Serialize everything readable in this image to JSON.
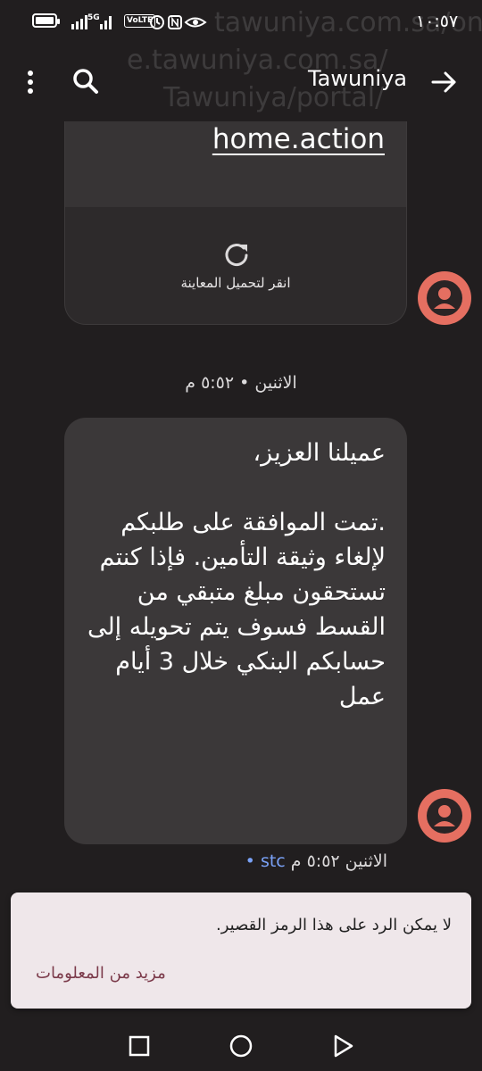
{
  "status_bar": {
    "time": "١٠:٥٧",
    "network": "5G",
    "volte": "VoLTE"
  },
  "watermark": {
    "line1": "وللمتابعة: tawuniya.com.sa/onlin",
    "line2": "e.tawuniya.com.sa/",
    "line3": "Tawuniya/portal/"
  },
  "header": {
    "title": "Tawuniya",
    "icons": {
      "menu": "more-vert-icon",
      "search": "search-icon",
      "back": "arrow-icon"
    }
  },
  "preview_bubble": {
    "link_text": "home.action",
    "load_preview_label": "انقر لتحميل المعاينة",
    "refresh_icon": "refresh-icon"
  },
  "timestamp_1": "الاثنين • ٥:٥٢ م",
  "message": {
    "text": "عميلنا العزيز،\n\n.تمت الموافقة على طلبكم لإلغاء وثيقة التأمين. فإذا كنتم تستحقون مبلغ متبقي من القسط فسوف يتم تحويله إلى حسابكم البنكي خلال 3 أيام عمل"
  },
  "timestamp_2": {
    "day_time": "الاثنين ٥:٥٢ م",
    "sim": "stc",
    "dot": "•"
  },
  "snackbar": {
    "text": "لا يمكن الرد على هذا الرمز القصير.",
    "action": "مزيد من المعلومات"
  },
  "colors": {
    "background": "#211e1f",
    "bubble": "#3b3839",
    "avatar": "#e56f61",
    "snackbar_bg": "#efe7ea",
    "snackbar_action": "#7b3a4a",
    "sim_label": "#7aa2f7"
  },
  "nav_bar": {
    "icons": [
      "recents-square-icon",
      "home-circle-icon",
      "back-triangle-icon"
    ]
  }
}
